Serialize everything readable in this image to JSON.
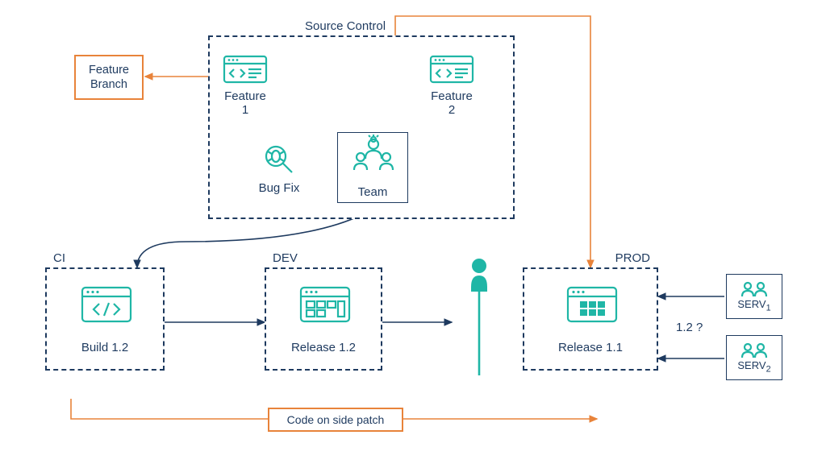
{
  "title": "Source Control",
  "feature_branch": "Feature\nBranch",
  "source_control": {
    "feature1": "Feature 1",
    "feature2": "Feature 2",
    "bugfix": "Bug Fix",
    "team": "Team"
  },
  "ci": {
    "title": "CI",
    "label": "Build 1.2"
  },
  "dev": {
    "title": "DEV",
    "label": "Release 1.2"
  },
  "prod": {
    "title": "PROD",
    "label": "Release 1.1"
  },
  "serv1": "SERV",
  "serv1_sub": "1",
  "serv2": "SERV",
  "serv2_sub": "2",
  "question": "1.2 ?",
  "patch": "Code on side patch",
  "colors": {
    "teal": "#1fb6a6",
    "navy": "#1e3a5f",
    "orange": "#e8833a"
  }
}
